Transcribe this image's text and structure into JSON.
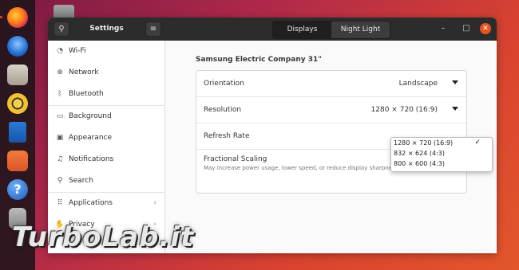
{
  "window": {
    "title": "Settings",
    "view_switcher": [
      {
        "label": "Displays",
        "active": true
      },
      {
        "label": "Night Light",
        "active": false
      }
    ]
  },
  "sidebar": {
    "items": [
      {
        "label": "Wi-Fi",
        "icon": "wifi-icon"
      },
      {
        "label": "Network",
        "icon": "network-icon"
      },
      {
        "label": "Bluetooth",
        "icon": "bluetooth-icon"
      },
      {
        "label": "Background",
        "icon": "background-icon"
      },
      {
        "label": "Appearance",
        "icon": "appearance-icon"
      },
      {
        "label": "Notifications",
        "icon": "bell-icon"
      },
      {
        "label": "Search",
        "icon": "search-icon"
      },
      {
        "label": "Applications",
        "icon": "apps-icon"
      },
      {
        "label": "Privacy",
        "icon": "hand-icon"
      }
    ]
  },
  "display": {
    "monitor_name": "Samsung Electric Company 31\"",
    "orientation": {
      "label": "Orientation",
      "value": "Landscape"
    },
    "resolution": {
      "label": "Resolution",
      "value": "1280 × 720 (16:9)"
    },
    "refresh_rate": {
      "label": "Refresh Rate"
    },
    "fractional_scaling": {
      "label": "Fractional Scaling",
      "description": "May increase power usage, lower speed, or reduce display sharpness.",
      "enabled": false
    },
    "resolution_options": [
      {
        "label": "1280 × 720 (16:9)",
        "selected": true
      },
      {
        "label": "832 × 624 (4:3)",
        "selected": false
      },
      {
        "label": "800 × 600 (4:3)",
        "selected": false
      }
    ]
  },
  "watermark": "TurboLab.it",
  "colors": {
    "accent": "#e95420",
    "headerbar": "#2c2c2c"
  }
}
